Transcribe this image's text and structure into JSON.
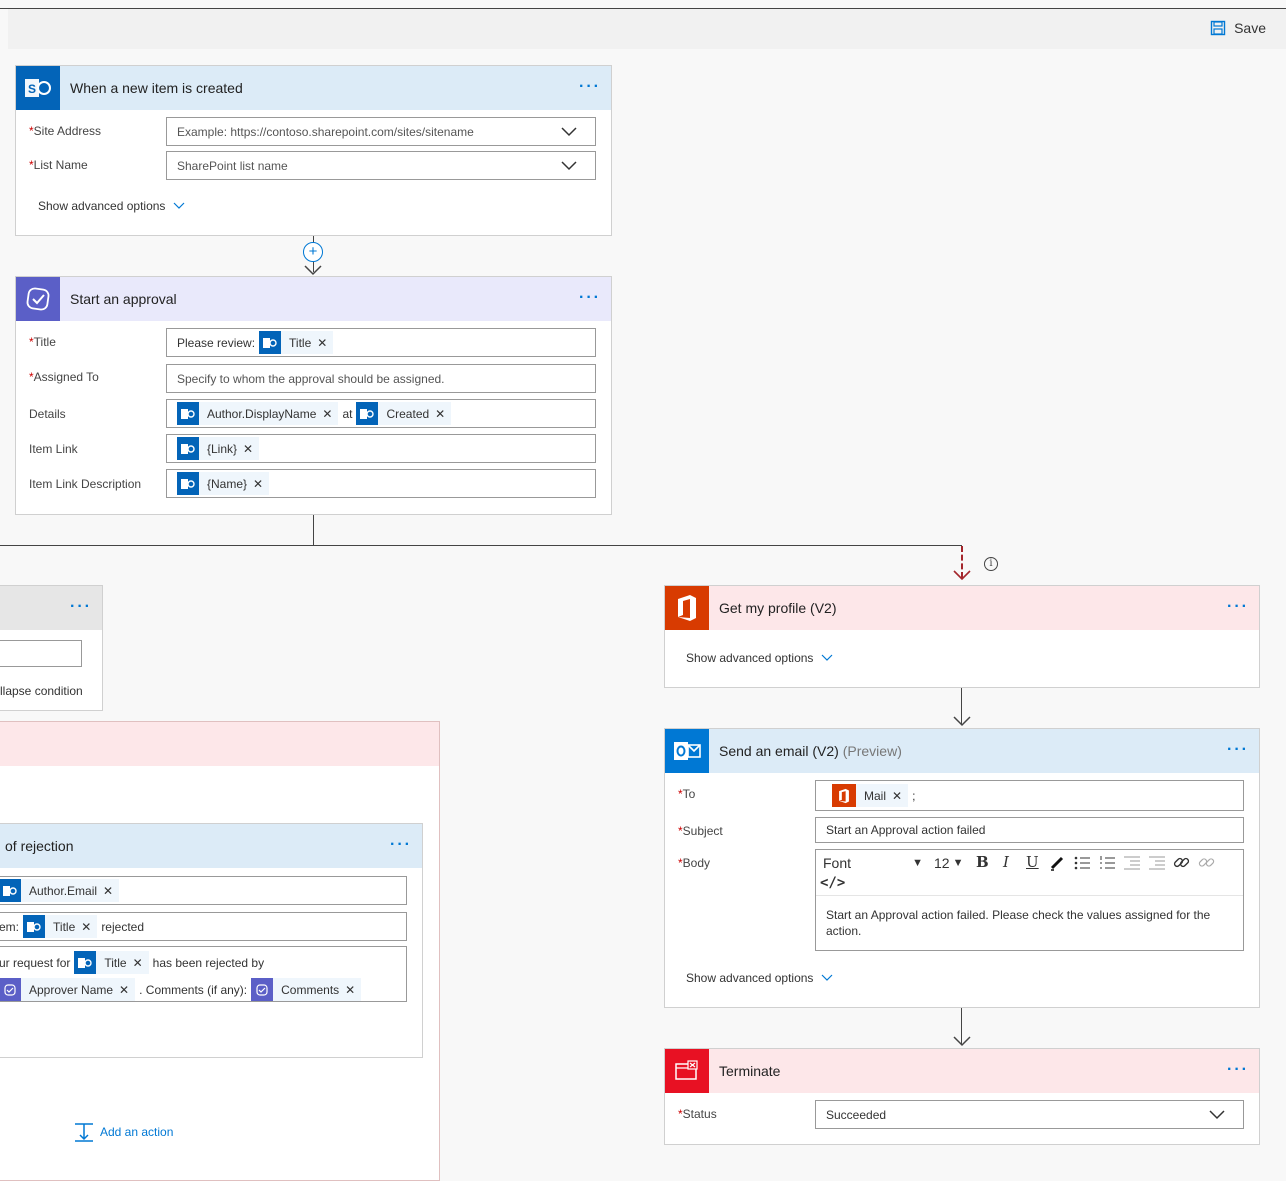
{
  "toolbar": {
    "save_label": "Save"
  },
  "trigger": {
    "title": "When a new item is created",
    "site_address_label": "Site Address",
    "site_address_placeholder": "Example: https://contoso.sharepoint.com/sites/sitename",
    "list_name_label": "List Name",
    "list_name_placeholder": "SharePoint list name",
    "advanced": "Show advanced options"
  },
  "approval": {
    "title": "Start an approval",
    "title_label": "Title",
    "title_prefix": "Please review:",
    "title_token": "Title",
    "assigned_label": "Assigned To",
    "assigned_placeholder": "Specify to whom the approval should be assigned.",
    "details_label": "Details",
    "details_token1": "Author.DisplayName",
    "details_at": "at",
    "details_token2": "Created",
    "item_link_label": "Item Link",
    "item_link_token": "{Link}",
    "item_link_desc_label": "Item Link Description",
    "item_link_desc_token": "{Name}"
  },
  "condition": {
    "collapse_text": "llapse condition"
  },
  "rejection": {
    "title": "of rejection",
    "to_token": "Author.Email",
    "subject_prefix": "em:",
    "subject_token": "Title",
    "subject_suffix": "rejected",
    "body_prefix": "ur request for",
    "body_token1": "Title",
    "body_mid": "has been rejected by",
    "body_token2": "Approver Name",
    "body_comments": ". Comments (if any):",
    "body_token3": "Comments",
    "add_action": "Add an action"
  },
  "profile": {
    "title": "Get my profile (V2)",
    "advanced": "Show advanced options"
  },
  "email": {
    "title": "Send an email (V2)",
    "title_suffix": "(Preview)",
    "to_label": "To",
    "to_token": "Mail",
    "to_sep": ";",
    "subject_label": "Subject",
    "subject_value": "Start an Approval action failed",
    "body_label": "Body",
    "font_label": "Font",
    "font_size": "12",
    "code_label": "</>",
    "body_value": "Start an Approval action failed. Please check the values assigned for the action.",
    "advanced": "Show advanced options"
  },
  "terminate": {
    "title": "Terminate",
    "status_label": "Status",
    "status_value": "Succeeded"
  },
  "required_mark": "*",
  "colors": {
    "sharepoint": "#0364b8",
    "approval": "#5b5fc7",
    "office": "#d83b01",
    "outlook": "#0078d4",
    "terminate": "#e81123",
    "link": "#0078d4"
  }
}
